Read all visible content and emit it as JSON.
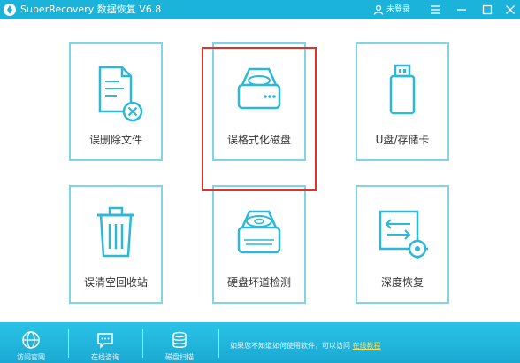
{
  "window": {
    "title": "SuperRecovery 数据恢复 V6.8",
    "login_label": "未登录",
    "controls": [
      "menu-icon",
      "minimize-icon",
      "maximize-icon",
      "close-icon"
    ],
    "accent_color": "#1bb3d9"
  },
  "cards": [
    {
      "label": "误删除文件",
      "icon": "deleted-file-icon"
    },
    {
      "label": "误格式化磁盘",
      "icon": "formatted-disk-icon",
      "highlighted": true
    },
    {
      "label": "U盘/存储卡",
      "icon": "usb-drive-icon"
    },
    {
      "label": "误清空回收站",
      "icon": "recycle-bin-icon"
    },
    {
      "label": "硬盘坏道检测",
      "icon": "bad-sector-disk-icon"
    },
    {
      "label": "深度恢复",
      "icon": "deep-recovery-icon"
    }
  ],
  "highlight_color": "#e0322d",
  "footer": {
    "items": [
      {
        "label": "访问官网",
        "icon": "globe-icon"
      },
      {
        "label": "在线咨询",
        "icon": "chat-icon"
      },
      {
        "label": "磁盘扫描",
        "icon": "database-icon"
      }
    ],
    "notice_text": "如果您不知道如何使用软件，可以访问",
    "notice_link": "在线教程"
  }
}
